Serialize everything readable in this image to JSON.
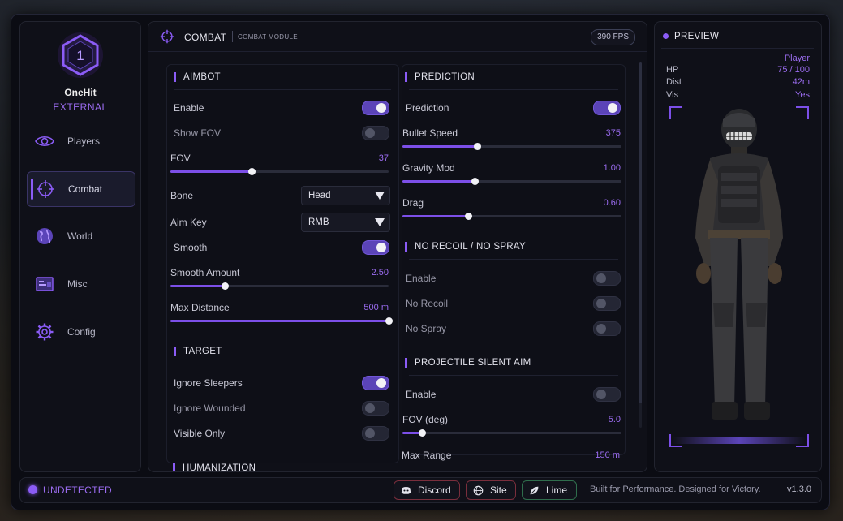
{
  "brand": {
    "level": "1",
    "name": "OneHit",
    "subtitle": "EXTERNAL"
  },
  "sidebar": {
    "items": [
      {
        "label": "Players",
        "icon": "eye-icon"
      },
      {
        "label": "Combat",
        "icon": "crosshair-icon",
        "active": true
      },
      {
        "label": "World",
        "icon": "globe-icon"
      },
      {
        "label": "Misc",
        "icon": "misc-icon"
      },
      {
        "label": "Config",
        "icon": "gear-icon"
      }
    ]
  },
  "header": {
    "title": "COMBAT",
    "subtitle": "COMBAT MODULE",
    "fps": "390 FPS"
  },
  "aimbot": {
    "title": "AIMBOT",
    "enable": {
      "label": "Enable",
      "on": true
    },
    "show_fov": {
      "label": "Show FOV",
      "on": false
    },
    "fov": {
      "label": "FOV",
      "value": "37",
      "level": 0.37
    },
    "bone": {
      "label": "Bone",
      "value": "Head"
    },
    "aim_key": {
      "label": "Aim Key",
      "value": "RMB"
    },
    "smooth": {
      "label": "Smooth",
      "on": true
    },
    "smooth_amount": {
      "label": "Smooth Amount",
      "value": "2.50",
      "level": 0.25
    },
    "max_distance": {
      "label": "Max Distance",
      "value": "500 m",
      "level": 1.0
    }
  },
  "target": {
    "title": "TARGET",
    "ignore_sleepers": {
      "label": "Ignore Sleepers",
      "on": true
    },
    "ignore_wounded": {
      "label": "Ignore Wounded",
      "on": false
    },
    "visible_only": {
      "label": "Visible Only",
      "on": false
    },
    "next_section_partial": "HUMANIZATION"
  },
  "prediction": {
    "title": "PREDICTION",
    "enable": {
      "label": "Prediction",
      "on": true
    },
    "bullet_speed": {
      "label": "Bullet Speed",
      "value": "375",
      "level": 0.34
    },
    "gravity_mod": {
      "label": "Gravity Mod",
      "value": "1.00",
      "level": 0.33
    },
    "drag": {
      "label": "Drag",
      "value": "0.60",
      "level": 0.3
    }
  },
  "no_recoil": {
    "title": "NO RECOIL / NO SPRAY",
    "enable": {
      "label": "Enable",
      "on": false
    },
    "no_recoil": {
      "label": "No Recoil",
      "on": false
    },
    "no_spray": {
      "label": "No Spray",
      "on": false
    }
  },
  "psa": {
    "title": "PROJECTILE SILENT AIM",
    "enable": {
      "label": "Enable",
      "on": false
    },
    "fov": {
      "label": "FOV (deg)",
      "value": "5.0",
      "level": 0.09
    },
    "max_range": {
      "label": "Max Range",
      "value": "150 m"
    }
  },
  "preview": {
    "title": "PREVIEW",
    "player_label": "Player",
    "hp": {
      "k": "HP",
      "v": "75 / 100"
    },
    "dist": {
      "k": "Dist",
      "v": "42m"
    },
    "vis": {
      "k": "Vis",
      "v": "Yes"
    }
  },
  "footer": {
    "status": "UNDETECTED",
    "discord": "Discord",
    "site": "Site",
    "lime": "Lime",
    "tagline": "Built for Performance. Designed for Victory.",
    "version": "v1.3.0"
  },
  "colors": {
    "accent": "#8b5cf6",
    "value_text": "#9b6cf0",
    "bg": "#0b0c13"
  }
}
